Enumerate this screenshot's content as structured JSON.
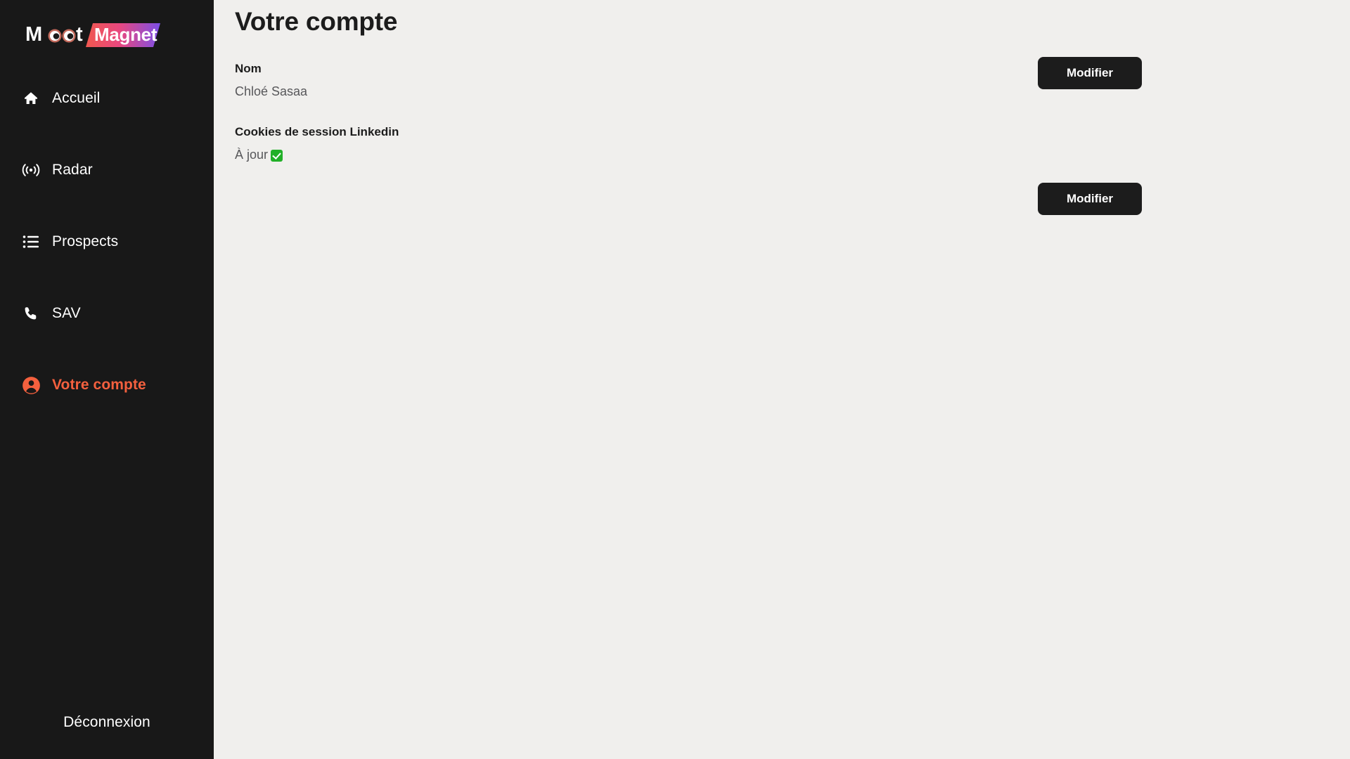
{
  "brand": {
    "name_part1": "Moot",
    "name_part2": "Magnet",
    "gradient_from": "#f05a5a",
    "gradient_to": "#7b4fe8"
  },
  "sidebar": {
    "items": [
      {
        "label": "Accueil",
        "icon": "home-icon",
        "active": false
      },
      {
        "label": "Radar",
        "icon": "radar-icon",
        "active": false
      },
      {
        "label": "Prospects",
        "icon": "list-icon",
        "active": false
      },
      {
        "label": "SAV",
        "icon": "phone-icon",
        "active": false
      },
      {
        "label": "Votre compte",
        "icon": "account-icon",
        "active": true
      }
    ],
    "logout_label": "Déconnexion",
    "active_color": "#f4603e",
    "background": "#181818"
  },
  "main": {
    "page_title": "Votre compte",
    "rows": [
      {
        "label": "Nom",
        "value": "Chloé Sasaa",
        "status_icon": "",
        "button_label": "Modifier"
      },
      {
        "label": "Cookies de session Linkedin",
        "value": "À jour",
        "status_icon": "white-check-mark",
        "button_label": "Modifier"
      }
    ],
    "background": "#f0efed"
  }
}
